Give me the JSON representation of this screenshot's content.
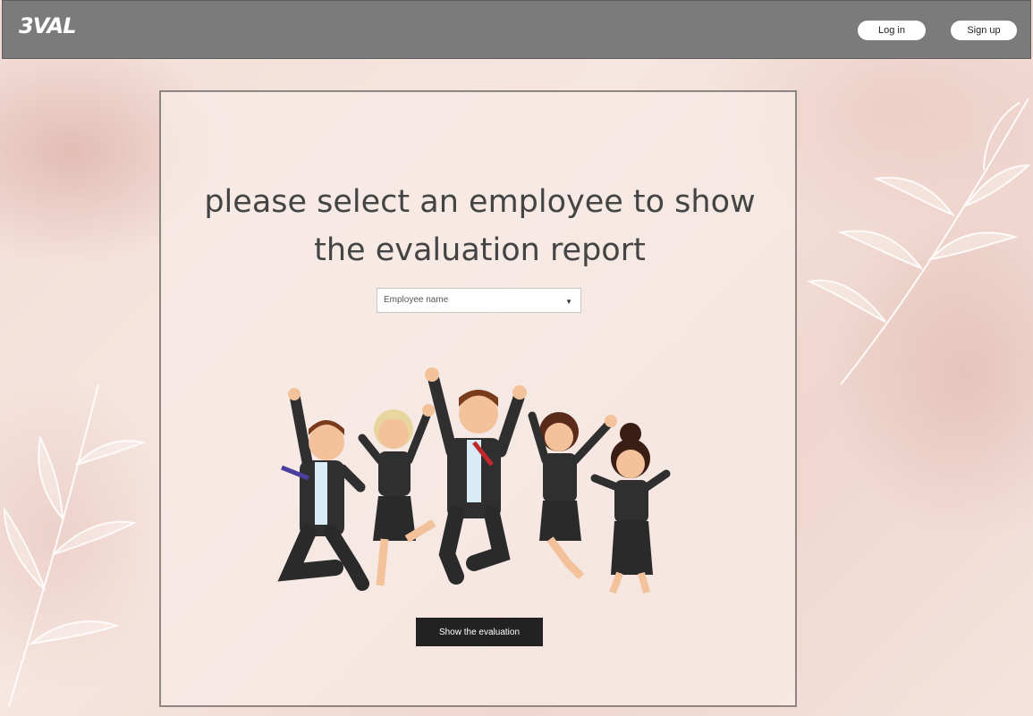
{
  "header": {
    "logo": "3VAL",
    "login_label": "Log in",
    "signup_label": "Sign up"
  },
  "main": {
    "heading_line1": "please select an employee to show",
    "heading_line2": "the evaluation report",
    "select_value": "Employee name",
    "show_button_label": "Show the evaluation"
  },
  "icons": {
    "dropdown": "caret-down-icon",
    "illustration": "celebrating-employees-illustration"
  },
  "colors": {
    "header_bg": "#7b7b7b",
    "button_dark": "#222222",
    "page_bg": "#f3ddd6"
  }
}
